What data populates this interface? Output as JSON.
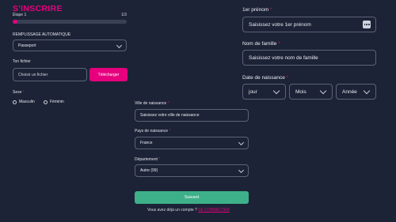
{
  "header": {
    "title": "S'INSCRIRE",
    "step_label": "Étape 1",
    "step_count": "1/3",
    "progress": 0.04
  },
  "autofill": {
    "label": "REMPLISSAGE AUTOMATIQUE",
    "value": "Passeport"
  },
  "file": {
    "label": "Ton fichier",
    "choose_label": "Choisir un fichier",
    "upload_label": "Télécharger"
  },
  "sex": {
    "label": "Sexe",
    "required_mark": "*",
    "options": [
      "Masculin",
      "Féminin"
    ]
  },
  "first_name": {
    "label": "1er prénom",
    "required_mark": "*",
    "placeholder": "Saisissez votre 1er prénom"
  },
  "last_name": {
    "label": "Nom de famille",
    "required_mark": "*",
    "placeholder": "Saisissez votre nom de famille"
  },
  "birth_date": {
    "label": "Date de naissance",
    "required_mark": "*",
    "day": "jour",
    "month": "Mois",
    "year": "Année"
  },
  "birth_city": {
    "label": "Ville de naissance",
    "required_mark": "*",
    "placeholder": "Saisissez votre ville de naissance"
  },
  "birth_country": {
    "label": "Pays de naissance",
    "required_mark": "*",
    "value": "France"
  },
  "department": {
    "label": "Département",
    "required_mark": "*",
    "value": "Autre (99)"
  },
  "submit": {
    "label": "Suivant"
  },
  "footer": {
    "question": "Vous avez déjà un compte ?",
    "login_link": "SE CONNECTER"
  },
  "colors": {
    "accent": "#e6007e",
    "submit": "#3db08a",
    "background": "#1d2336"
  }
}
